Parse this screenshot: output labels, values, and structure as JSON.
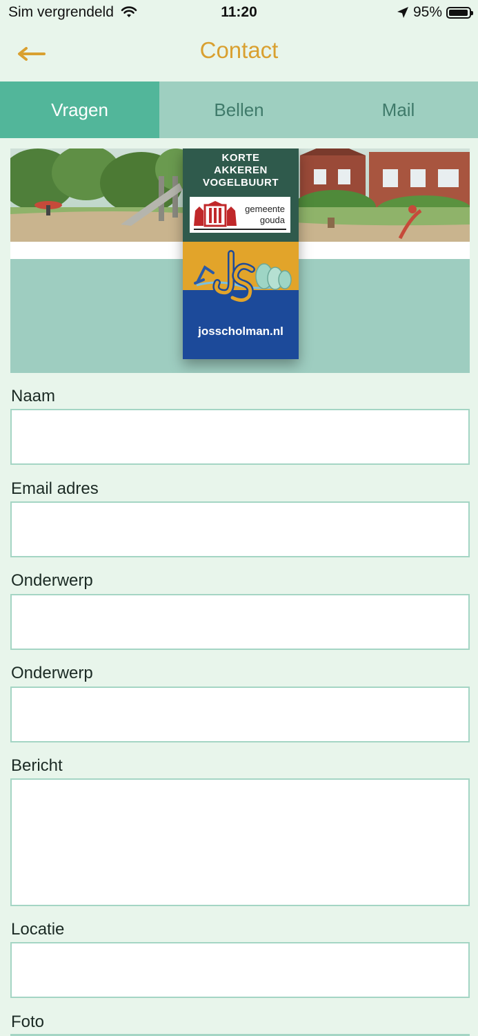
{
  "status_bar": {
    "carrier": "Sim vergrendeld",
    "time": "11:20",
    "battery": "95%",
    "battery_level": 0.95
  },
  "nav": {
    "title": "Contact",
    "back_icon": "arrow-left-icon",
    "accent_color": "#d9a030"
  },
  "tabs": [
    {
      "label": "Vragen",
      "active": true
    },
    {
      "label": "Bellen",
      "active": false
    },
    {
      "label": "Mail",
      "active": false
    }
  ],
  "banner": {
    "logo_lines": [
      "KORTE",
      "AKKEREN",
      "VOGELBUURT"
    ],
    "gouda_line1": "gemeente",
    "gouda_line2": "gouda",
    "url": "josscholman.nl"
  },
  "form": {
    "naam_label": "Naam",
    "naam_value": "",
    "email_label": "Email adres",
    "email_value": "",
    "onderwerp_label": "Onderwerp",
    "onderwerp_value": "",
    "onderwerp2_label": "Onderwerp",
    "onderwerp2_value": "",
    "bericht_label": "Bericht",
    "bericht_value": "",
    "locatie_label": "Locatie",
    "locatie_value": "",
    "foto_label": "Foto"
  },
  "colors": {
    "background": "#e8f5eb",
    "tab_active": "#52b69a",
    "tab_inactive": "#9ecfc0",
    "input_border": "#a4d5c4"
  }
}
